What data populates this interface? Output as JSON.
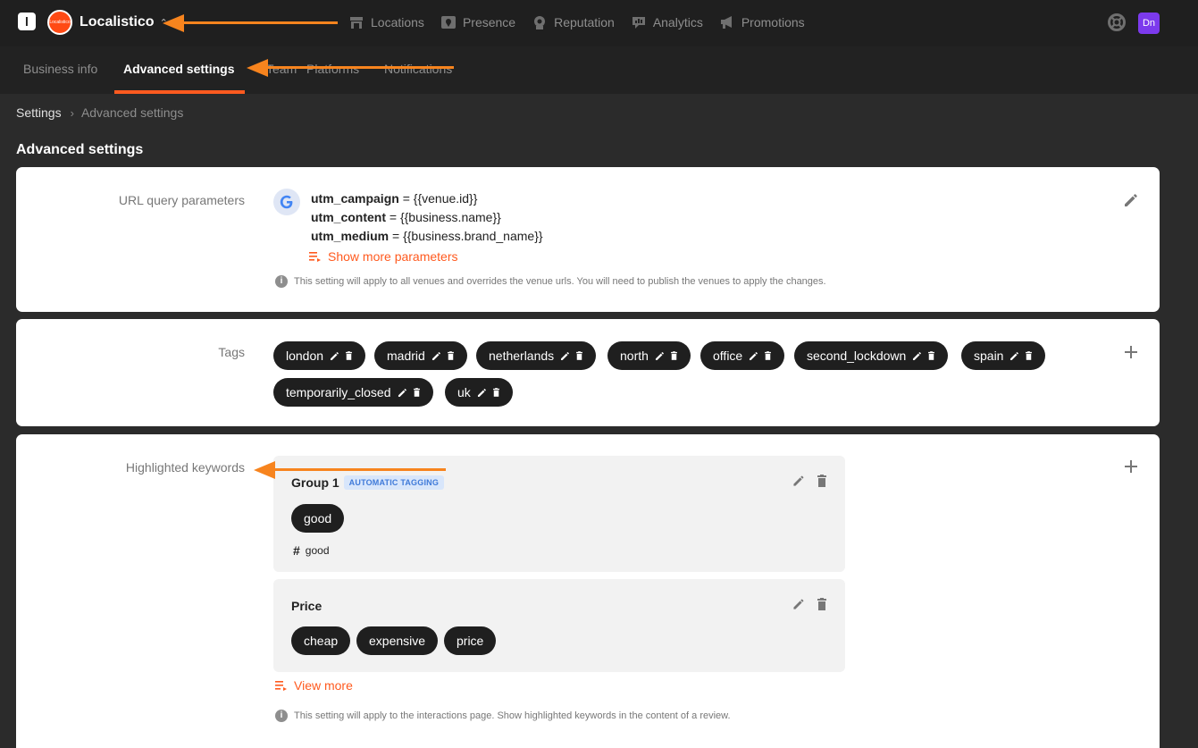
{
  "topbar": {
    "app_logo": "l",
    "business": {
      "name": "Localistico",
      "avatar_text": "Localistico"
    },
    "nav": [
      {
        "label": "Locations",
        "icon": "store-icon"
      },
      {
        "label": "Presence",
        "icon": "presence-pin-icon"
      },
      {
        "label": "Reputation",
        "icon": "reputation-badge-icon"
      },
      {
        "label": "Analytics",
        "icon": "analytics-icon"
      },
      {
        "label": "Promotions",
        "icon": "megaphone-icon"
      }
    ],
    "user_initials": "Dn"
  },
  "subnav": {
    "tabs": [
      {
        "label": "Business info",
        "active": false
      },
      {
        "label": "Advanced settings",
        "active": true
      },
      {
        "label": "Team",
        "active": false
      },
      {
        "label": "Platforms",
        "active": false
      },
      {
        "label": "Notifications",
        "active": false
      }
    ]
  },
  "breadcrumb": {
    "root": "Settings",
    "current": "Advanced settings"
  },
  "page_title": "Advanced settings",
  "url_params": {
    "label": "URL query parameters",
    "params": [
      {
        "key": "utm_campaign",
        "value": " = {{venue.id}}"
      },
      {
        "key": "utm_content",
        "value": " = {{business.name}}"
      },
      {
        "key": "utm_medium",
        "value": " = {{business.brand_name}}"
      }
    ],
    "show_more": "Show more parameters",
    "info": "This setting will apply to all venues and overrides the venue urls. You will need to publish the venues to apply the changes."
  },
  "tags": {
    "label": "Tags",
    "items": [
      "london",
      "madrid",
      "netherlands",
      "north",
      "office",
      "second_lockdown",
      "spain",
      "temporarily_closed",
      "uk"
    ]
  },
  "keywords": {
    "label": "Highlighted keywords",
    "groups": [
      {
        "title": "Group 1",
        "badge": "AUTOMATIC TAGGING",
        "keywords": [
          "good"
        ],
        "hashtag": "good"
      },
      {
        "title": "Price",
        "badge": "",
        "keywords": [
          "cheap",
          "expensive",
          "price"
        ],
        "hashtag": ""
      }
    ],
    "view_more": "View more",
    "info": "This setting will apply to the interactions page. Show highlighted keywords in the content of a review."
  },
  "colors": {
    "accent": "#ff5a1f",
    "annotation_arrow": "#f7841e",
    "topbar": "#1f1f1f",
    "user_avatar": "#7c3aed"
  }
}
